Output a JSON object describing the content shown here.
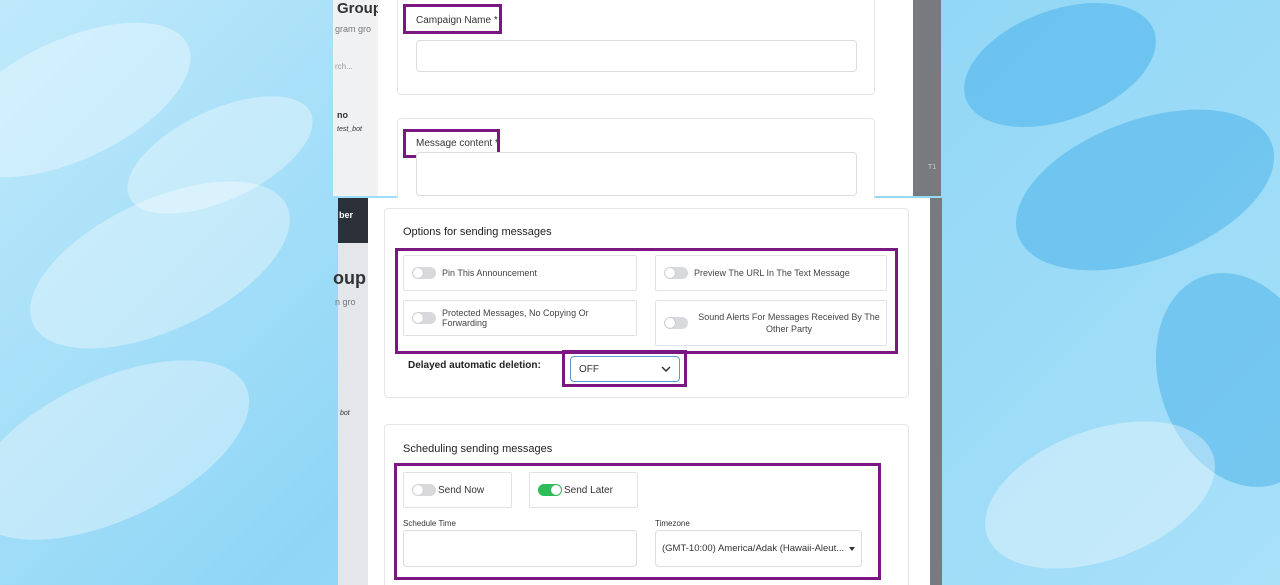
{
  "background_left_text": {
    "group_title_1": "Group",
    "group_sub_1": "gram gro",
    "search_placeholder": "rch...",
    "col_header": "no",
    "bot_name_1": "test_bot",
    "header_cell": "ber",
    "group_title_2": "oup",
    "group_sub_2": "n gro",
    "bot_name_2": "bot",
    "right_stub": "T1"
  },
  "campaign": {
    "name_label": "Campaign Name *",
    "name_value": "",
    "message_label": "Message content *",
    "message_value": ""
  },
  "options": {
    "title": "Options for sending messages",
    "items": [
      {
        "label": "Pin This Announcement",
        "enabled": false
      },
      {
        "label": "Preview The URL In The Text Message",
        "enabled": false
      },
      {
        "label": "Protected Messages, No Copying Or Forwarding",
        "enabled": false
      },
      {
        "label": "Sound Alerts For Messages Received By The Other Party",
        "enabled": false
      }
    ],
    "deletion_label": "Delayed automatic deletion:",
    "deletion_value": "OFF"
  },
  "scheduling": {
    "title": "Scheduling sending messages",
    "send_now_label": "Send Now",
    "send_now_on": false,
    "send_later_label": "Send Later",
    "send_later_on": true,
    "schedule_time_label": "Schedule Time",
    "schedule_time_value": "",
    "timezone_label": "Timezone",
    "timezone_value": "(GMT-10:00) America/Adak (Hawaii-Aleut..."
  },
  "colors": {
    "highlight": "#7a1780",
    "toggle_on": "#2ebd59",
    "toggle_off": "#d7d9dc"
  }
}
